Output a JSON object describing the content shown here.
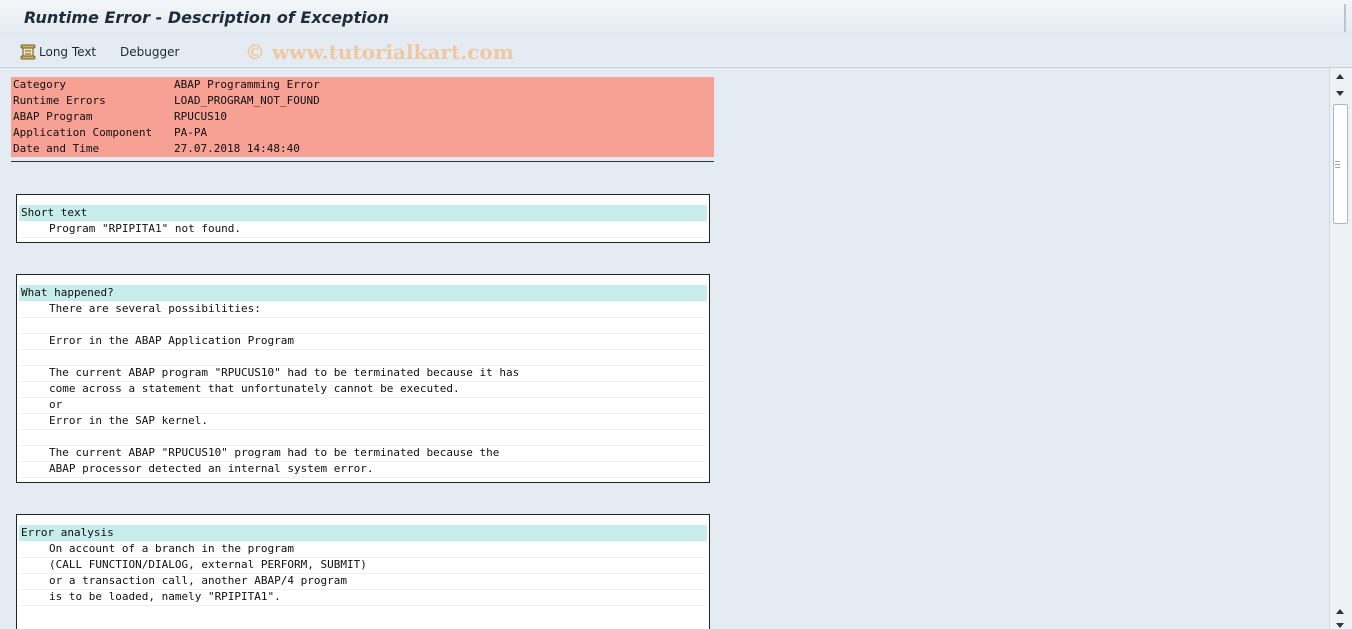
{
  "window": {
    "title": "Runtime Error - Description of Exception"
  },
  "toolbar": {
    "long_text_label": "Long Text",
    "long_text_icon": "long-text-icon",
    "debugger_label": "Debugger"
  },
  "watermark": "© www.tutorialkart.com",
  "header": {
    "rows": [
      {
        "key": "Category",
        "value": "ABAP Programming Error"
      },
      {
        "key": "Runtime Errors",
        "value": "LOAD_PROGRAM_NOT_FOUND"
      },
      {
        "key": "ABAP Program",
        "value": "RPUCUS10"
      },
      {
        "key": "Application Component",
        "value": "PA-PA"
      },
      {
        "key": "Date and Time",
        "value": "27.07.2018 14:48:40"
      }
    ],
    "color": "#f7a094"
  },
  "sections": [
    {
      "title": "Short text",
      "lines": [
        "Program \"RPIPITA1\" not found."
      ]
    },
    {
      "title": "What happened?",
      "lines": [
        "There are several possibilities:",
        "",
        "Error in the ABAP Application Program",
        "",
        "The current ABAP program \"RPUCUS10\" had to be terminated because it has",
        "come across a statement that unfortunately cannot be executed.",
        "or",
        "Error in the SAP kernel.",
        "",
        "The current ABAP \"RPUCUS10\" program had to be terminated because the",
        "ABAP processor detected an internal system error."
      ]
    },
    {
      "title": "Error analysis",
      "lines": [
        "On account of a branch in the program",
        "(CALL FUNCTION/DIALOG, external PERFORM, SUBMIT)",
        "or a transaction call, another ABAP/4 program",
        "is to be loaded, namely \"RPIPITA1\"."
      ]
    }
  ],
  "colors": {
    "section_header": "#c6ecec",
    "background": "#e4ebf2"
  }
}
